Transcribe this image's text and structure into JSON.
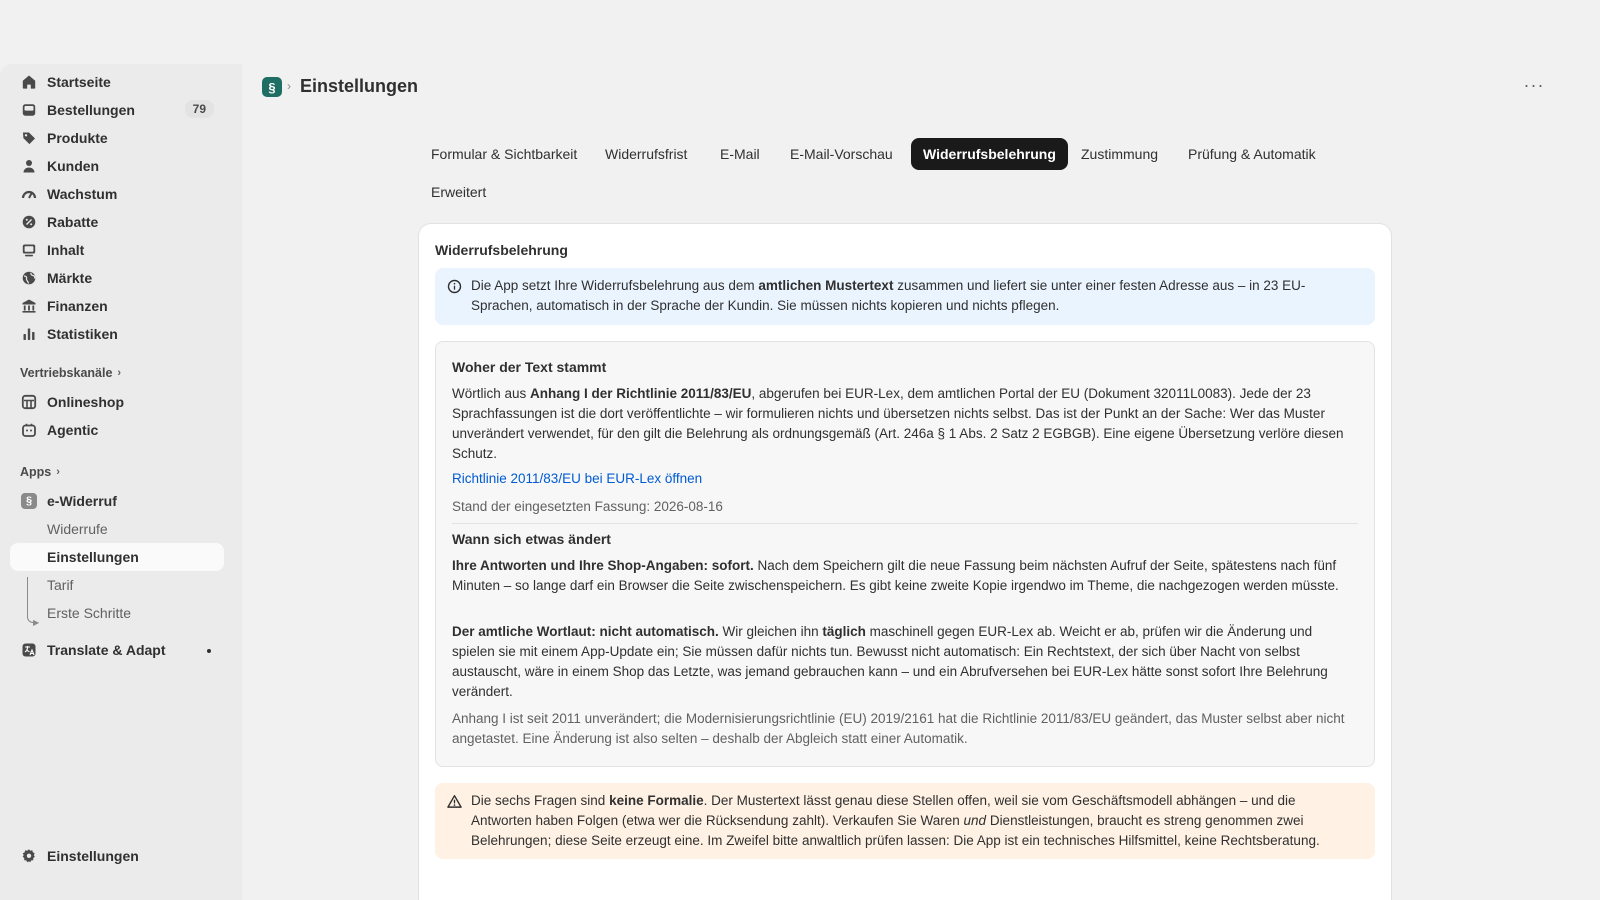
{
  "sidebar": {
    "main_items": [
      {
        "icon": "home-icon",
        "label": "Startseite"
      },
      {
        "icon": "inbox-icon",
        "label": "Bestellungen",
        "badge": "79"
      },
      {
        "icon": "tag-icon",
        "label": "Produkte"
      },
      {
        "icon": "person-icon",
        "label": "Kunden"
      },
      {
        "icon": "gauge-icon",
        "label": "Wachstum"
      },
      {
        "icon": "discount-icon",
        "label": "Rabatte"
      },
      {
        "icon": "content-icon",
        "label": "Inhalt"
      },
      {
        "icon": "globe-icon",
        "label": "Märkte"
      },
      {
        "icon": "bank-icon",
        "label": "Finanzen"
      },
      {
        "icon": "bar-chart-icon",
        "label": "Statistiken"
      }
    ],
    "sales_channels": {
      "label": "Vertriebskanäle",
      "items": [
        {
          "icon": "store-icon",
          "label": "Onlineshop"
        },
        {
          "icon": "agentic-icon",
          "label": "Agentic"
        }
      ]
    },
    "apps": {
      "label": "Apps",
      "app": {
        "icon_glyph": "§",
        "label": "e-Widerruf"
      },
      "sub_items": [
        "Widerrufe",
        "Einstellungen",
        "Tarif",
        "Erste Schritte"
      ],
      "active_sub_item": "Einstellungen",
      "other_app": {
        "icon": "translate-icon",
        "label": "Translate & Adapt"
      }
    },
    "settings_label": "Einstellungen"
  },
  "header": {
    "app_icon_glyph": "§",
    "title": "Einstellungen",
    "more_label": "···"
  },
  "tabs": [
    "Formular & Sichtbarkeit",
    "Widerrufsfrist",
    "E-Mail",
    "E-Mail-Vorschau",
    "Widerrufsbelehrung",
    "Zustimmung",
    "Prüfung & Automatik",
    "Erweitert"
  ],
  "active_tab": "Widerrufsbelehrung",
  "card": {
    "title": "Widerrufsbelehrung",
    "info_banner": {
      "text_before": "Die App setzt Ihre Widerrufsbelehrung aus dem ",
      "text_bold": "amtlichen Mustertext",
      "text_after": " zusammen und liefert sie unter einer festen Adresse aus – in 23 EU-Sprachen, automatisch in der Sprache der Kundin. Sie müssen nichts kopieren und nichts pflegen."
    },
    "source_section": {
      "title": "Woher der Text stammt",
      "p1_before": "Wörtlich aus ",
      "p1_bold": "Anhang I der Richtlinie 2011/83/EU",
      "p1_after": ", abgerufen bei EUR-Lex, dem amtlichen Portal der EU (Dokument 32011L0083). Jede der 23 Sprachfassungen ist die dort veröffentlichte – wir formulieren nichts und übersetzen nichts selbst. Das ist der Punkt an der Sache: Wer das Muster unverändert verwendet, für den gilt die Belehrung als ordnungsgemäß (Art. 246a § 1 Abs. 2 Satz 2 EGBGB). Eine eigene Übersetzung verlöre diesen Schutz.",
      "link": "Richtlinie 2011/83/EU bei EUR-Lex öffnen",
      "version_line": "Stand der eingesetzten Fassung: 2026-08-16"
    },
    "change_section": {
      "title": "Wann sich etwas ändert",
      "p1_bold": "Ihre Antworten und Ihre Shop-Angaben: sofort.",
      "p1_after": " Nach dem Speichern gilt die neue Fassung beim nächsten Aufruf der Seite, spätestens nach fünf Minuten – so lange darf ein Browser die Seite zwischenspeichern. Es gibt keine zweite Kopie irgendwo im Theme, die nachgezogen werden müsste.",
      "p2_bold": "Der amtliche Wortlaut: nicht automatisch.",
      "p2_mid1": " Wir gleichen ihn ",
      "p2_bold2": "täglich",
      "p2_after": " maschinell gegen EUR-Lex ab. Weicht er ab, prüfen wir die Änderung und spielen sie mit einem App-Update ein; Sie müssen dafür nichts tun. Bewusst nicht automatisch: Ein Rechtstext, der sich über Nacht von selbst austauscht, wäre in einem Shop das Letzte, was jemand gebrauchen kann – und ein Abrufversehen bei EUR-Lex hätte sonst sofort Ihre Belehrung verändert.",
      "note": "Anhang I ist seit 2011 unverändert; die Modernisierungsrichtlinie (EU) 2019/2161 hat die Richtlinie 2011/83/EU geändert, das Muster selbst aber nicht angetastet. Eine Änderung ist also selten – deshalb der Abgleich statt einer Automatik."
    },
    "warning_banner": {
      "text_before": "Die sechs Fragen sind ",
      "text_bold": "keine Formalie",
      "text_mid": ". Der Mustertext lässt genau diese Stellen offen, weil sie vom Geschäftsmodell abhängen – und die Antworten haben Folgen (etwa wer die Rücksendung zahlt). Verkaufen Sie Waren ",
      "text_italic": "und",
      "text_after": " Dienstleistungen, braucht es streng genommen zwei Belehrungen; diese Seite erzeugt eine. Im Zweifel bitte anwaltlich prüfen lassen: Die App ist ein technisches Hilfsmittel, keine Rechtsberatung."
    }
  },
  "colors": {
    "active_tab_bg": "#1a1a1a",
    "app_icon_bg": "#1f6e63",
    "info_banner_bg": "#eaf4ff",
    "warning_banner_bg": "#fff1e3",
    "link": "#005bd3"
  }
}
